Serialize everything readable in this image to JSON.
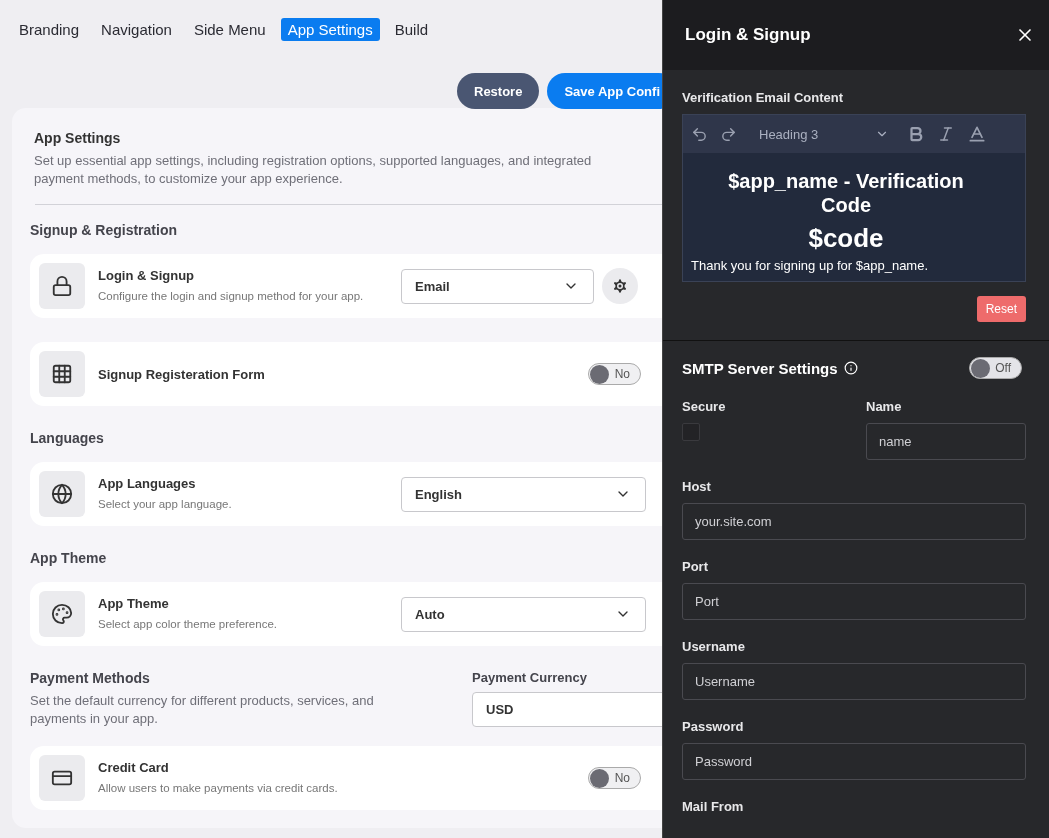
{
  "tabs": [
    {
      "label": "Branding",
      "selected": false
    },
    {
      "label": "Navigation",
      "selected": false
    },
    {
      "label": "Side Menu",
      "selected": false
    },
    {
      "label": "App Settings",
      "selected": true
    },
    {
      "label": "Build",
      "selected": false
    }
  ],
  "actions": {
    "restore": "Restore",
    "save": "Save App Confi"
  },
  "settings": {
    "title": "App Settings",
    "description": "Set up essential app settings, including registration options, supported languages, and integrated payment methods, to customize your app experience.",
    "sections": [
      {
        "heading": "Signup & Registration",
        "items": [
          {
            "kind": "select",
            "title": "Login & Signup",
            "description": "Configure the login and signup method for your app.",
            "value": "Email",
            "gear": true
          },
          {
            "kind": "toggle",
            "title": "Signup Registeration Form",
            "on": false,
            "toggle_label": "No"
          }
        ]
      },
      {
        "heading": "Languages",
        "items": [
          {
            "kind": "select",
            "title": "App Languages",
            "description": "Select your app language.",
            "value": "English",
            "gear": false
          }
        ]
      },
      {
        "heading": "App Theme",
        "items": [
          {
            "kind": "select",
            "title": "App Theme",
            "description": "Select app color theme preference.",
            "value": "Auto",
            "gear": false
          }
        ]
      },
      {
        "heading": "Payment Methods",
        "description": "Set the default currency for different products, services, and payments in your app.",
        "currency": {
          "label": "Payment Currency",
          "value": "USD"
        },
        "items": [
          {
            "kind": "toggle",
            "title": "Credit Card",
            "description": "Allow users to make payments via credit cards.",
            "on": false,
            "toggle_label": "No"
          }
        ]
      }
    ]
  },
  "panel": {
    "title": "Login & Signup",
    "editor": {
      "label": "Verification Email Content",
      "block_style": "Heading 3",
      "heading": "$app_name - Verification Code",
      "code": "$code",
      "body": "Thank you for signing up for $app_name."
    },
    "reset": "Reset",
    "smtp": {
      "title": "SMTP Server Settings",
      "on": false,
      "toggle_label": "Off",
      "secure": {
        "label": "Secure",
        "checked": false
      },
      "name": {
        "label": "Name",
        "placeholder": "name"
      },
      "fields": [
        {
          "label": "Host",
          "placeholder": "your.site.com"
        },
        {
          "label": "Port",
          "placeholder": "Port"
        },
        {
          "label": "Username",
          "placeholder": "Username"
        },
        {
          "label": "Password",
          "placeholder": "Password"
        }
      ],
      "next_label": "Mail From"
    }
  }
}
